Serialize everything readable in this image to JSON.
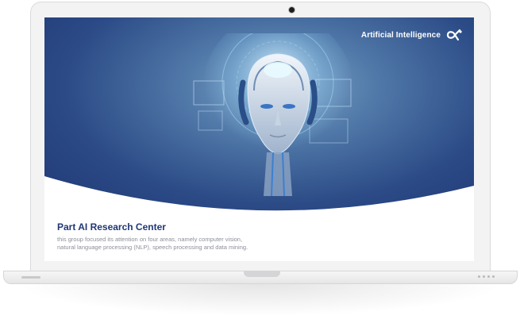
{
  "brand": {
    "name": "Artificial Intelligence",
    "logo_icon": "ai-logo-icon"
  },
  "hero": {
    "image_icon": "ai-robot-head-illustration"
  },
  "content": {
    "title": "Part AI Research Center",
    "description_line1": "this group focused its attention on four areas, namely computer vision,",
    "description_line2": "natural language processing (NLP), speech processing and data mining."
  },
  "colors": {
    "hero_dark": "#1f3775",
    "hero_light": "#7fa6c8",
    "title": "#1f3775",
    "description": "#8b8f98"
  }
}
